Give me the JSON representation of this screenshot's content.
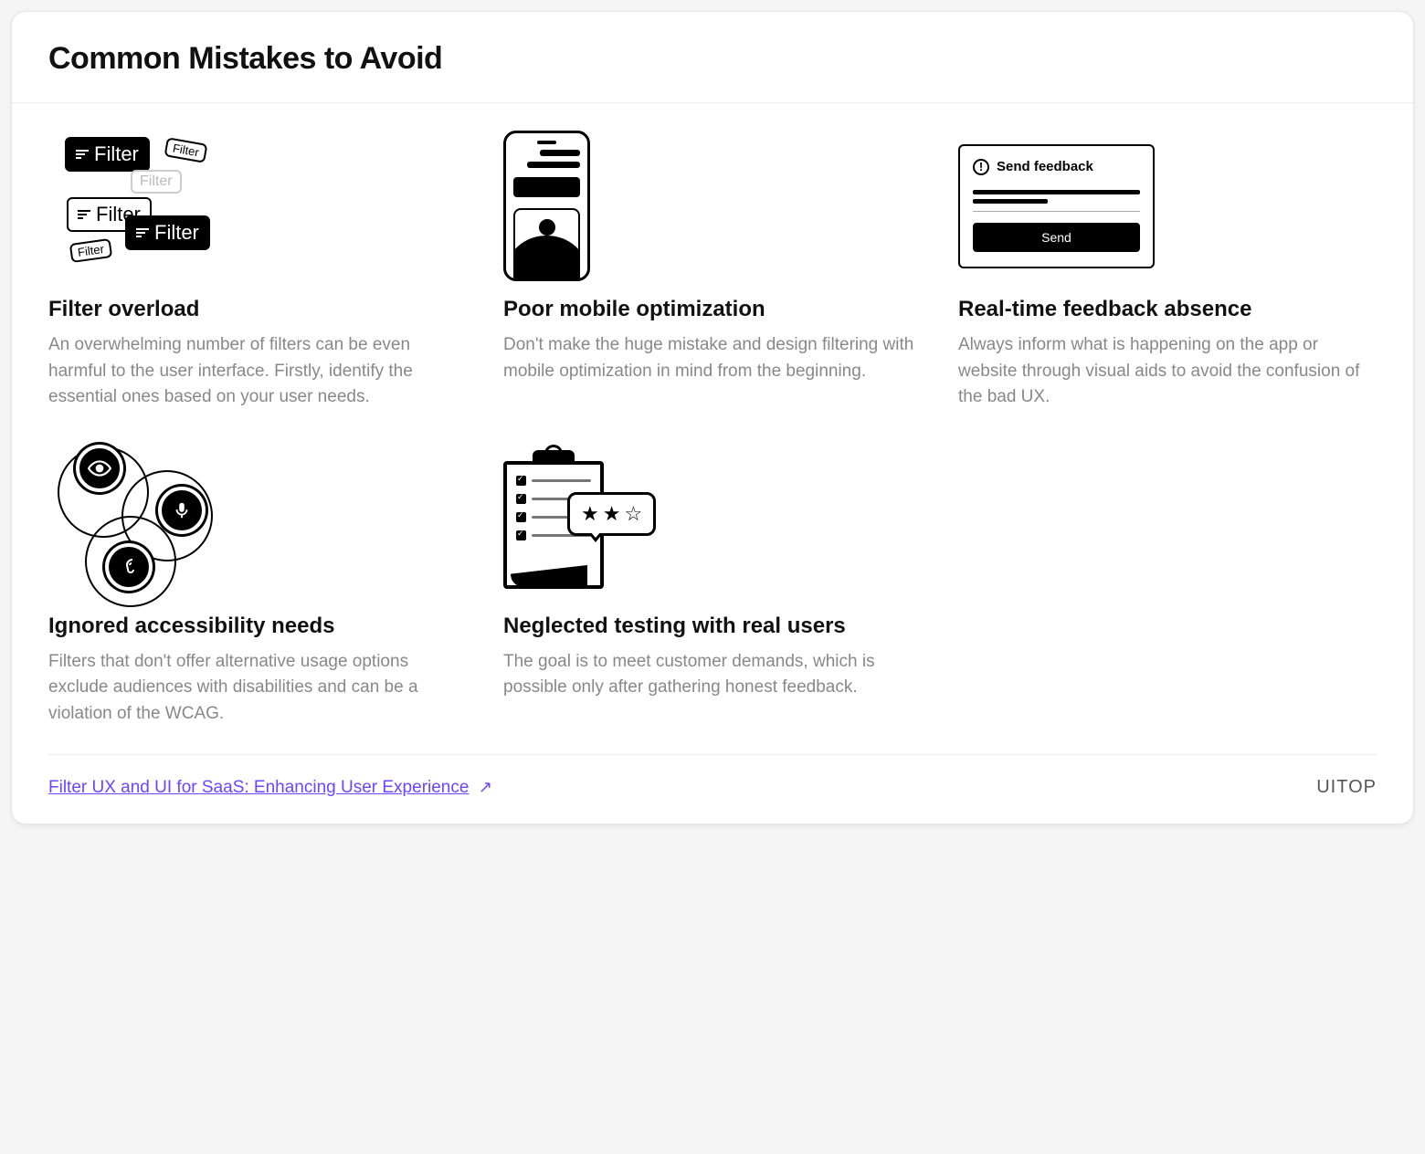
{
  "title": "Common Mistakes to Avoid",
  "items": [
    {
      "heading": "Filter overload",
      "body": "An overwhelming number of filters can be even harmful to the user interface. Firstly, identify the essential ones based on your user needs.",
      "chip_label": "Filter"
    },
    {
      "heading": "Poor mobile optimization",
      "body": "Don't make the huge mistake and design filtering with mobile optimization in mind from the beginning."
    },
    {
      "heading": "Real-time feedback absence",
      "body": "Always inform what is happening on the app or website through visual aids to avoid the confusion of the bad UX.",
      "fb_title": "Send feedback",
      "fb_button": "Send"
    },
    {
      "heading": "Ignored accessibility needs",
      "body": "Filters that don't offer alternative usage options exclude audiences with disabilities and can be a violation of the WCAG."
    },
    {
      "heading": "Neglected testing with real users",
      "body": "The goal is to meet customer demands, which is possible only after gathering honest feedback."
    }
  ],
  "footer": {
    "link_text": "Filter UX and UI for SaaS: Enhancing User Experience",
    "brand": "UITOP"
  }
}
